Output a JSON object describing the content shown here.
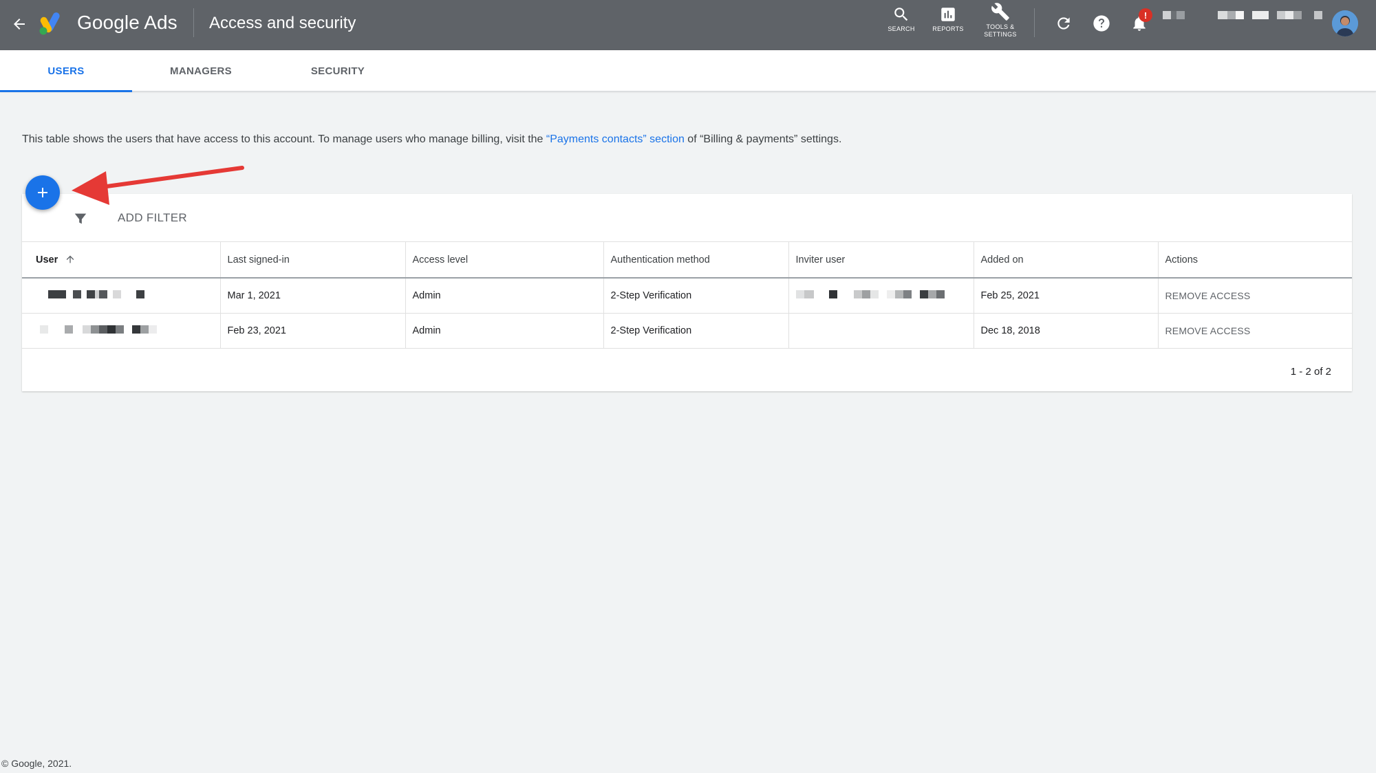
{
  "header": {
    "brand": "Google Ads",
    "title": "Access and security",
    "tools": [
      {
        "label": "SEARCH",
        "icon": "search-icon"
      },
      {
        "label": "REPORTS",
        "icon": "reports-icon"
      },
      {
        "label": "TOOLS &\nSETTINGS",
        "icon": "wrench-icon"
      }
    ],
    "notification_badge": "!"
  },
  "tabs": [
    {
      "label": "USERS",
      "active": true
    },
    {
      "label": "MANAGERS",
      "active": false
    },
    {
      "label": "SECURITY",
      "active": false
    }
  ],
  "description": {
    "before": "This table shows the users that have access to this account. To manage users who manage billing, visit the ",
    "link": "“Payments contacts” section",
    "after": " of “Billing & payments” settings."
  },
  "filter": {
    "label": "ADD FILTER"
  },
  "table": {
    "columns": [
      "User",
      "Last signed-in",
      "Access level",
      "Authentication method",
      "Inviter user",
      "Added on",
      "Actions"
    ],
    "rows": [
      {
        "last_signed_in": "Mar 1, 2021",
        "access_level": "Admin",
        "auth": "2-Step Verification",
        "added_on": "Feb 25, 2021",
        "action": "REMOVE ACCESS"
      },
      {
        "last_signed_in": "Feb 23, 2021",
        "access_level": "Admin",
        "auth": "2-Step Verification",
        "added_on": "Dec 18, 2018",
        "action": "REMOVE ACCESS"
      }
    ],
    "pagination": "1 - 2 of 2"
  },
  "footer": "© Google, 2021.",
  "colors": {
    "topbar": "#5f6368",
    "accent": "#1a73e8",
    "annotation_arrow": "#e53935",
    "badge": "#d93025"
  }
}
